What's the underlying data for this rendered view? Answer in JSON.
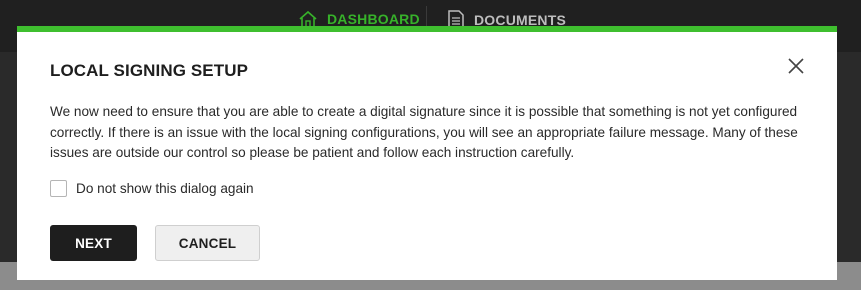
{
  "nav": {
    "dashboard": {
      "label": "DASHBOARD",
      "icon": "home-icon"
    },
    "documents": {
      "label": "DOCUMENTS",
      "icon": "document-icon"
    }
  },
  "dialog": {
    "title": "LOCAL SIGNING SETUP",
    "body": "We now need to ensure that you are able to create a digital signature since it is possible that something is not yet configured correctly. If there is an issue with the local signing configurations, you will see an appropriate failure message. Many of these issues are outside our control so please be patient and follow each instruction carefully.",
    "checkbox_label": "Do not show this dialog again",
    "checkbox_checked": false,
    "next_label": "NEXT",
    "cancel_label": "CANCEL",
    "close_icon": "close-icon"
  },
  "colors": {
    "accent": "#3fbf2f",
    "nav_active": "#37b22a",
    "primary_button": "#1e1e1e"
  }
}
